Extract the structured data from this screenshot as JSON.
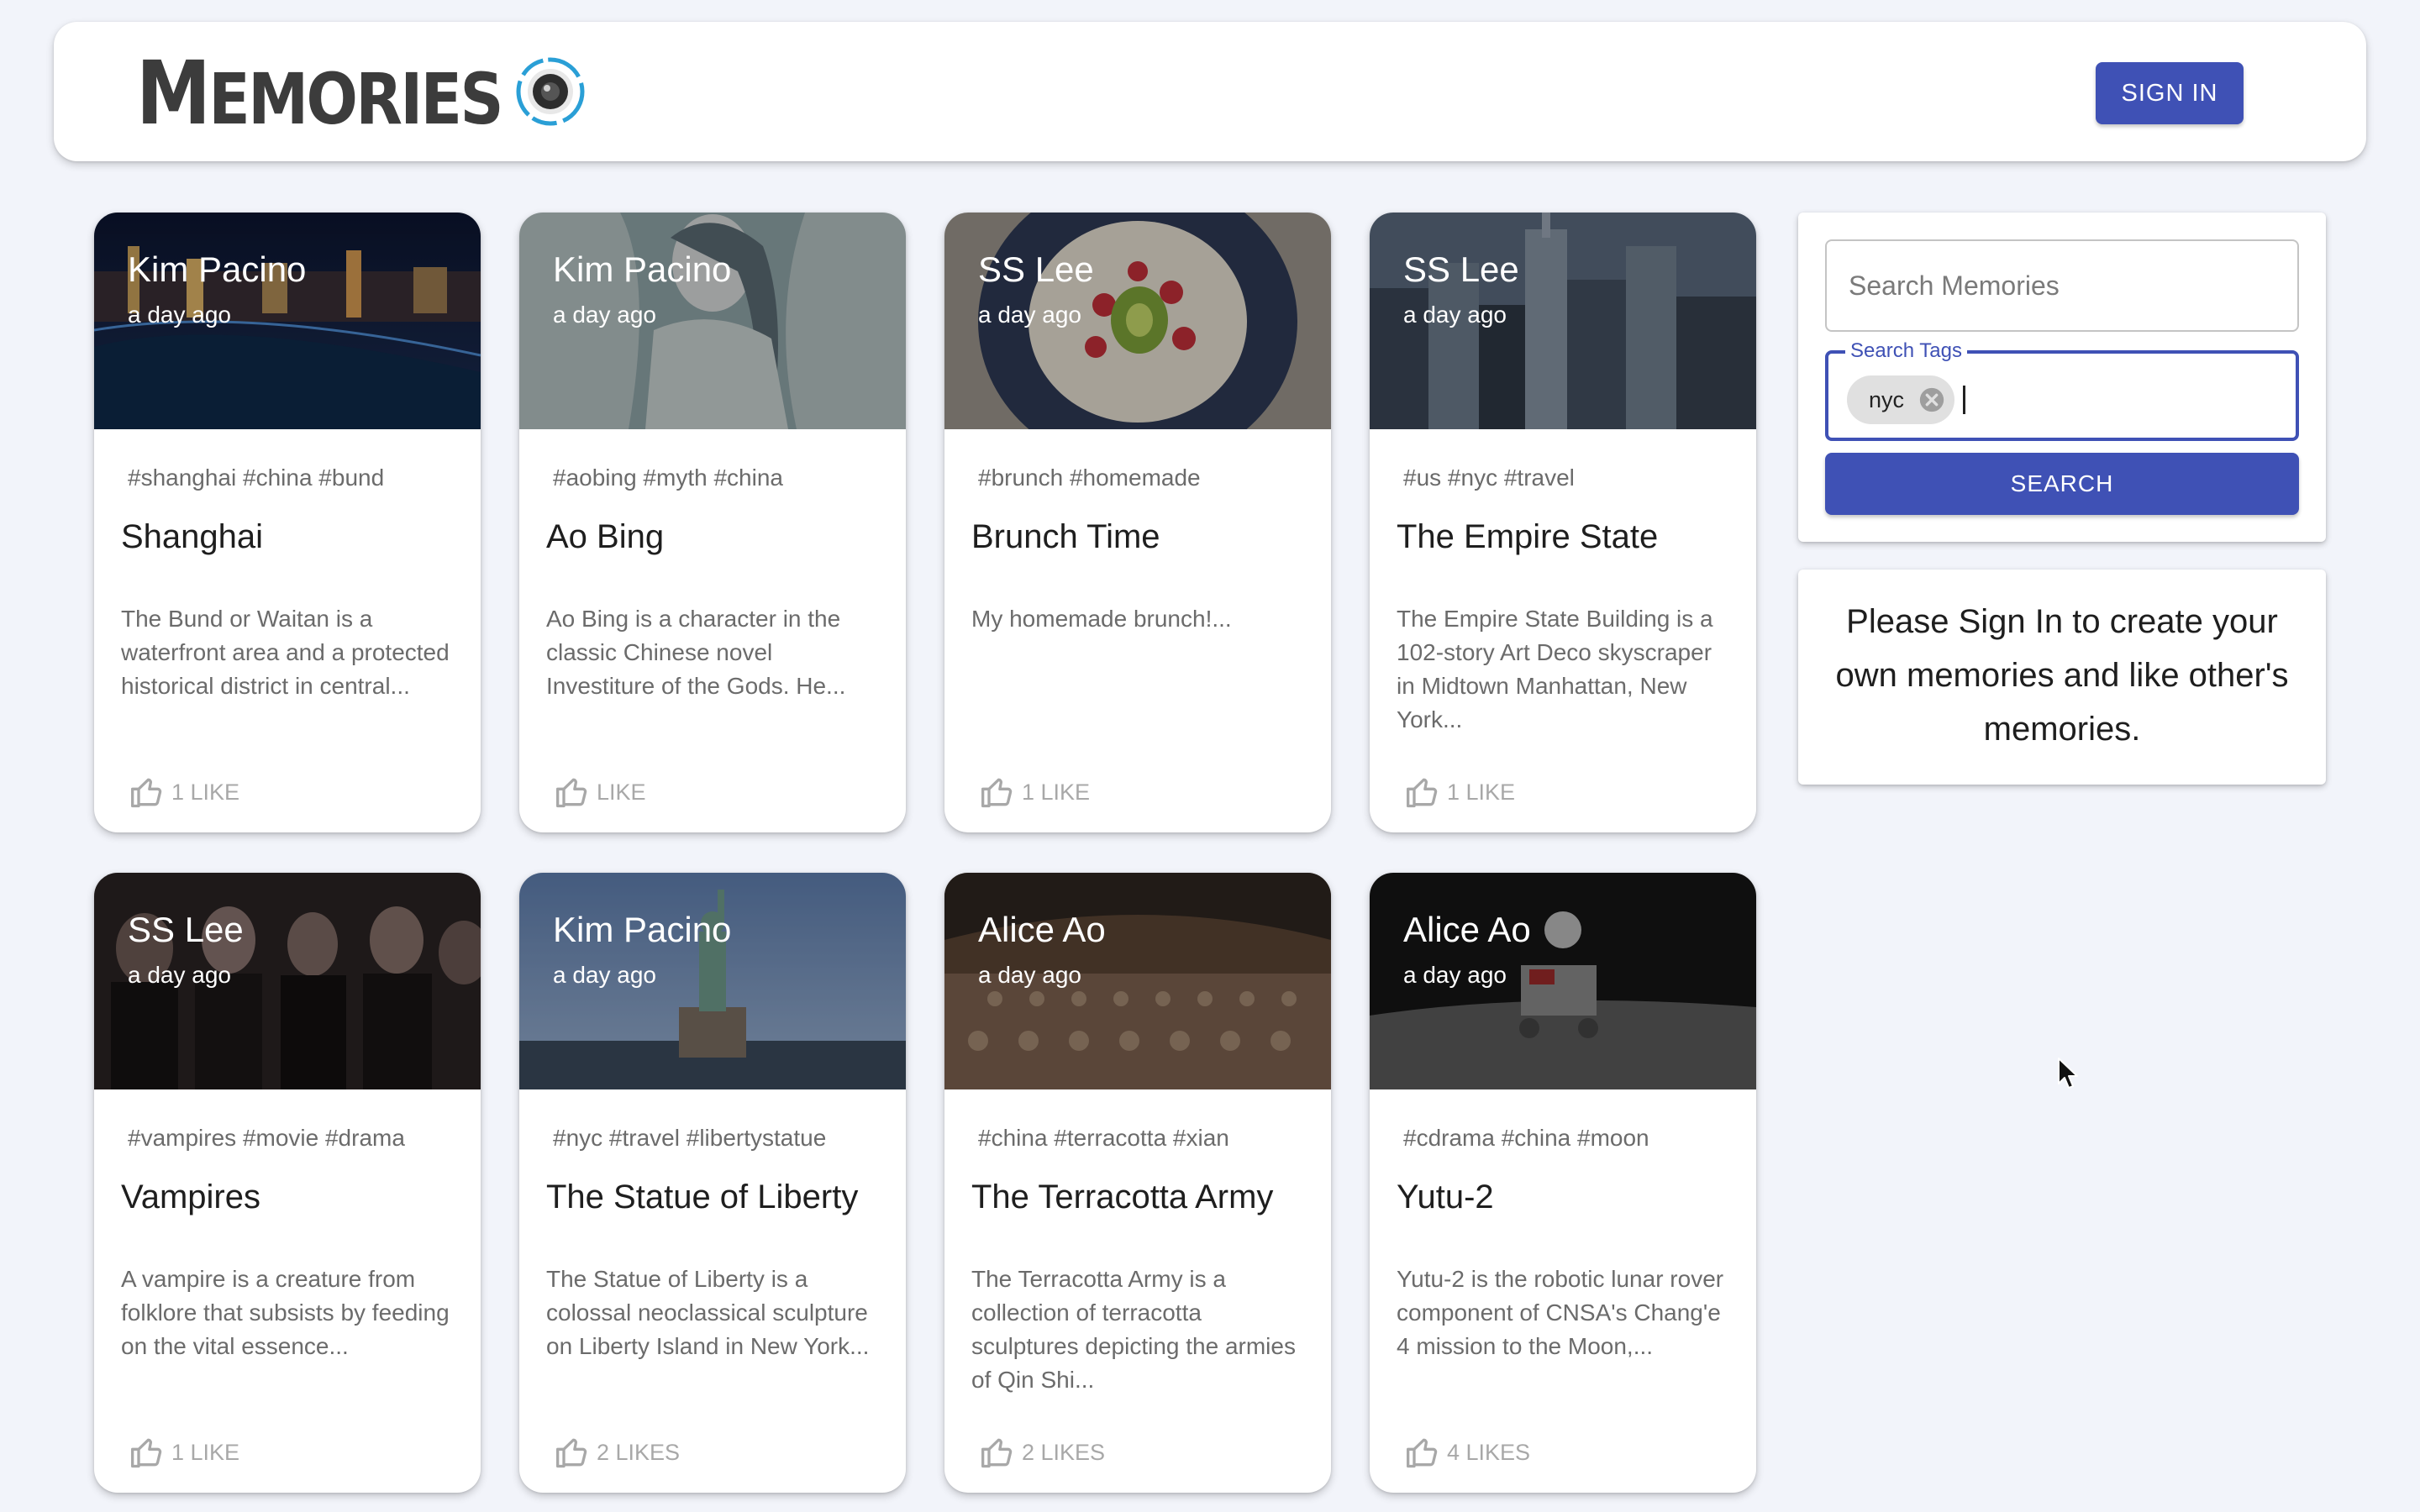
{
  "header": {
    "brand_first": "M",
    "brand_rest": "EMORIES",
    "signin_label": "SIGN IN"
  },
  "search": {
    "placeholder": "Search Memories",
    "tags_label": "Search Tags",
    "chips": [
      "nyc"
    ],
    "button_label": "SEARCH"
  },
  "info": {
    "message": "Please Sign In to create your own memories and like other's memories."
  },
  "icons": {
    "logo": "camera-lens-icon",
    "like": "thumb-up-icon",
    "chip_delete": "cancel-circle-icon"
  },
  "colors": {
    "primary": "#3f51b5",
    "background": "#f2f4fa"
  },
  "posts": [
    {
      "creator": "Kim Pacino",
      "time": "a day ago",
      "tags": "#shanghai #china #bund",
      "title": "Shanghai",
      "message": "The Bund or Waitan is a waterfront area and a protected historical district in central...",
      "likes": "1 LIKE"
    },
    {
      "creator": "Kim Pacino",
      "time": "a day ago",
      "tags": "#aobing #myth #china",
      "title": "Ao Bing",
      "message": "Ao Bing is a character in the classic Chinese novel Investiture of the Gods. He...",
      "likes": "LIKE"
    },
    {
      "creator": "SS Lee",
      "time": "a day ago",
      "tags": "#brunch #homemade",
      "title": "Brunch Time",
      "message": "My homemade brunch!...",
      "likes": "1 LIKE"
    },
    {
      "creator": "SS Lee",
      "time": "a day ago",
      "tags": "#us #nyc #travel",
      "title": "The Empire State",
      "message": "The Empire State Building is a 102-story Art Deco skyscraper in Midtown Manhattan, New York...",
      "likes": "1 LIKE"
    },
    {
      "creator": "SS Lee",
      "time": "a day ago",
      "tags": "#vampires #movie #drama",
      "title": "Vampires",
      "message": "A vampire is a creature from folklore that subsists by feeding on the vital essence...",
      "likes": "1 LIKE"
    },
    {
      "creator": "Kim Pacino",
      "time": "a day ago",
      "tags": "#nyc #travel #libertystatue",
      "title": "The Statue of Liberty",
      "message": "The Statue of Liberty is a colossal neoclassical sculpture on Liberty Island in New York...",
      "likes": "2 LIKES"
    },
    {
      "creator": "Alice Ao",
      "time": "a day ago",
      "tags": "#china #terracotta #xian",
      "title": "The Terracotta Army",
      "message": "The Terracotta Army is a collection of terracotta sculptures depicting the armies of Qin Shi...",
      "likes": "2 LIKES"
    },
    {
      "creator": "Alice Ao",
      "time": "a day ago",
      "tags": "#cdrama #china #moon",
      "title": "Yutu-2",
      "message": "Yutu-2 is the robotic lunar rover component of CNSA's Chang'e 4 mission to the Moon,...",
      "likes": "4 LIKES"
    }
  ]
}
